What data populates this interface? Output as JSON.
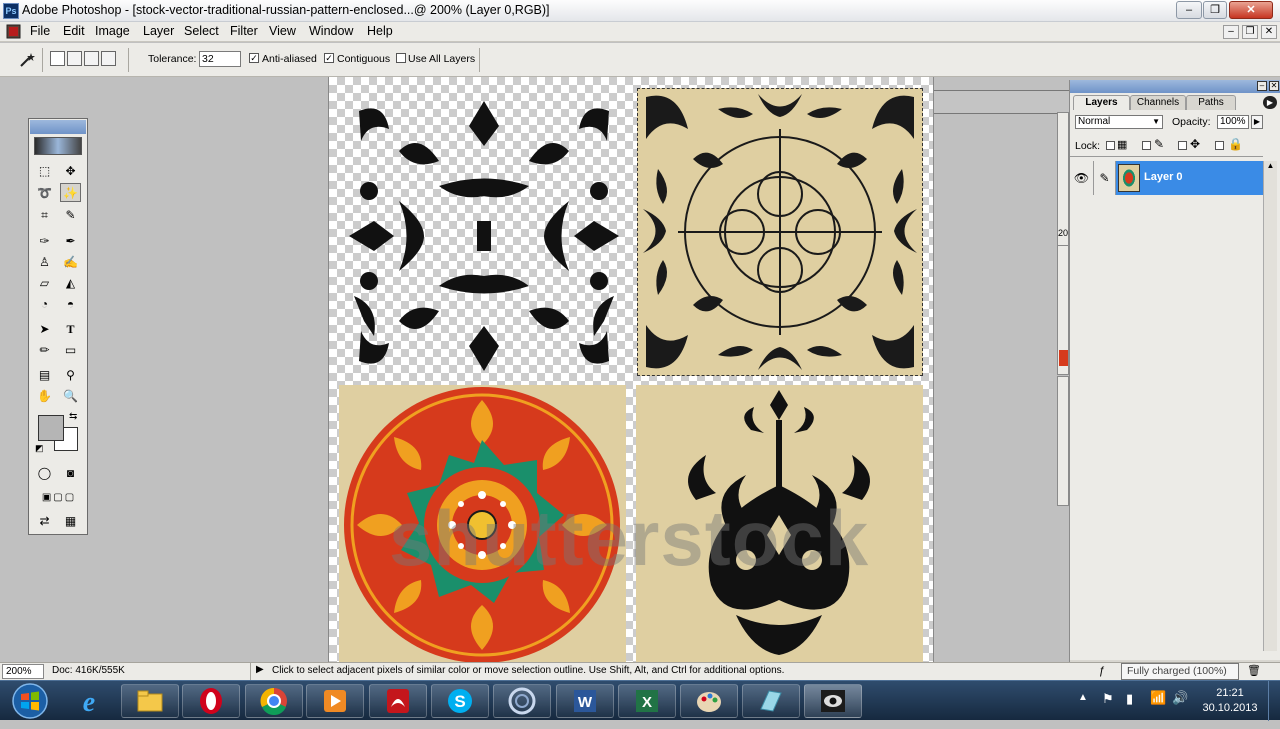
{
  "titlebar": {
    "title": "Adobe Photoshop - [stock-vector-traditional-russian-pattern-enclosed...@ 200% (Layer 0,RGB)]",
    "app_icon": "Ps"
  },
  "menu": {
    "items": [
      "File",
      "Edit",
      "Image",
      "Layer",
      "Select",
      "Filter",
      "View",
      "Window",
      "Help"
    ]
  },
  "options": {
    "tolerance_label": "Tolerance:",
    "tolerance_value": "32",
    "anti_aliased_label": "Anti-aliased",
    "anti_aliased_checked": true,
    "contiguous_label": "Contiguous",
    "contiguous_checked": true,
    "use_all_layers_label": "Use All Layers",
    "use_all_layers_checked": false,
    "check_glyph": "✓"
  },
  "canvas": {
    "watermark": "shutterstock"
  },
  "layers_panel": {
    "tabs": [
      "Layers",
      "Channels",
      "Paths"
    ],
    "blend_mode": "Normal",
    "opacity_label": "Opacity:",
    "opacity_value": "100%",
    "lock_label": "Lock:",
    "layer_name": "Layer 0",
    "partial_label": "20"
  },
  "status": {
    "zoom": "200%",
    "doc": "Doc: 416K/555K",
    "hint": "Click to select adjacent pixels of similar color or move selection outline.  Use Shift, Alt, and Ctrl for additional options."
  },
  "taskbar": {
    "apps": [
      "internet-explorer",
      "file-explorer",
      "opera",
      "chrome",
      "media-player",
      "acrobat-reader",
      "skype",
      "app-swirl",
      "word",
      "excel",
      "paint",
      "notepad-app",
      "photoshop-eye"
    ],
    "tooltip": "Fully charged (100%)",
    "time": "21:21",
    "date": "30.10.2013"
  },
  "colors": {
    "accent": "#3a8be6",
    "tile_beige": "#dfcfa1",
    "ornament_red": "#d63a1c",
    "ornament_green": "#1a8f6b",
    "ornament_orange": "#f0a020"
  }
}
